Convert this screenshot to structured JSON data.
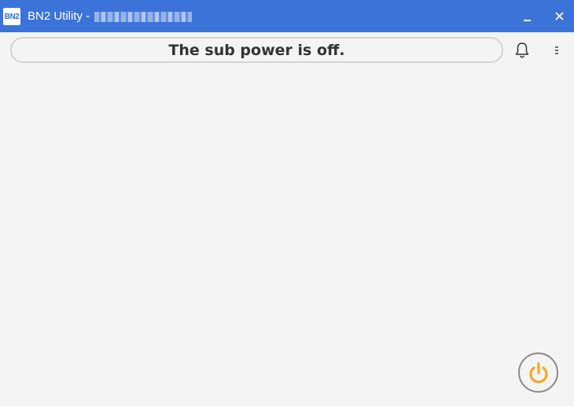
{
  "window": {
    "title": "BN2 Utility -",
    "title_redacted": true,
    "logo_text": "BN2",
    "accent_color": "#3b73d9"
  },
  "window_controls": {
    "minimize_icon": "minimize-icon",
    "close_icon": "close-icon"
  },
  "status": {
    "message": "The sub power is off."
  },
  "toolbar": {
    "notification_icon": "bell-icon",
    "menu_icon": "more-vertical-icon"
  },
  "power": {
    "icon": "power-icon",
    "color": "#f5a623"
  }
}
